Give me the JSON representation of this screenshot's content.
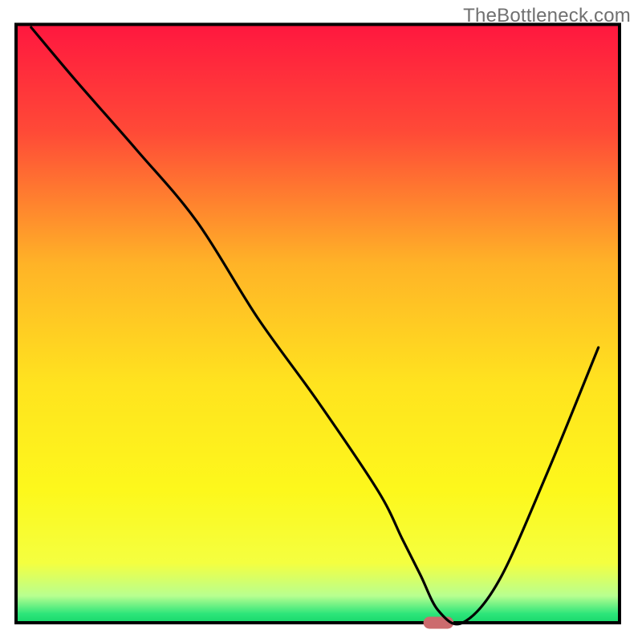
{
  "watermark": "TheBottleneck.com",
  "chart_data": {
    "type": "line",
    "title": "",
    "xlabel": "",
    "ylabel": "",
    "xlim": [
      0,
      100
    ],
    "ylim": [
      0,
      100
    ],
    "grid": false,
    "legend": false,
    "background_gradient_stops": [
      {
        "offset": 0.0,
        "color": "#ff173f"
      },
      {
        "offset": 0.18,
        "color": "#ff4a37"
      },
      {
        "offset": 0.4,
        "color": "#ffb327"
      },
      {
        "offset": 0.6,
        "color": "#ffe31f"
      },
      {
        "offset": 0.78,
        "color": "#fdf81c"
      },
      {
        "offset": 0.9,
        "color": "#f4ff40"
      },
      {
        "offset": 0.955,
        "color": "#b8ff90"
      },
      {
        "offset": 0.985,
        "color": "#2de57a"
      },
      {
        "offset": 1.0,
        "color": "#17d86b"
      }
    ],
    "series": [
      {
        "name": "bottleneck-curve",
        "color": "#000000",
        "x": [
          2.5,
          10,
          20,
          30,
          40,
          50,
          60,
          64,
          67,
          70,
          74,
          80,
          88,
          96.5
        ],
        "y": [
          99.5,
          90.5,
          79,
          67,
          51,
          37,
          22,
          14,
          8,
          2,
          0,
          7,
          25,
          46
        ]
      }
    ],
    "marker": {
      "name": "optimal-point",
      "x": 70,
      "y": 0,
      "color": "#cc6b6e",
      "width_pct": 5.0,
      "height_pct": 2.0
    },
    "frame": {
      "left_pct": 2.5,
      "top_pct": 3.8,
      "right_pct": 96.5,
      "bottom_pct": 97.0,
      "stroke": "#000000",
      "stroke_width_px": 4
    }
  }
}
